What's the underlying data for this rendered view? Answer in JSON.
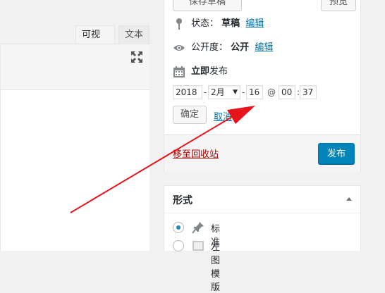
{
  "editor": {
    "tabs": [
      {
        "label": "可视化",
        "active": true
      },
      {
        "label": "文本",
        "active": false
      }
    ],
    "fullscreen_icon": "expand-icon"
  },
  "publish": {
    "save_draft_label": "保存草稿",
    "preview_label": "预览",
    "status_label": "状态：",
    "status_value": "草稿",
    "status_edit": "编辑",
    "visibility_label": "公开度：",
    "visibility_value": "公开",
    "visibility_edit": "编辑",
    "schedule_bold": "立即",
    "schedule_rest": "发布",
    "date": {
      "year": "2018",
      "month": "2月",
      "day": "16",
      "hour": "00",
      "minute": "37",
      "at": "@",
      "dash": "-",
      "colon": ":"
    },
    "ok_label": "确定",
    "cancel_label": "取消",
    "trash_label": "移至回收站",
    "publish_label": "发布",
    "publish_color": "#0085ba"
  },
  "format": {
    "title": "形式",
    "options": [
      {
        "label": "标准",
        "icon": "pin-icon",
        "checked": true
      },
      {
        "label": "左图模版",
        "icon": "image-icon",
        "checked": false
      }
    ]
  },
  "annotation": {
    "color": "#e8141b"
  }
}
